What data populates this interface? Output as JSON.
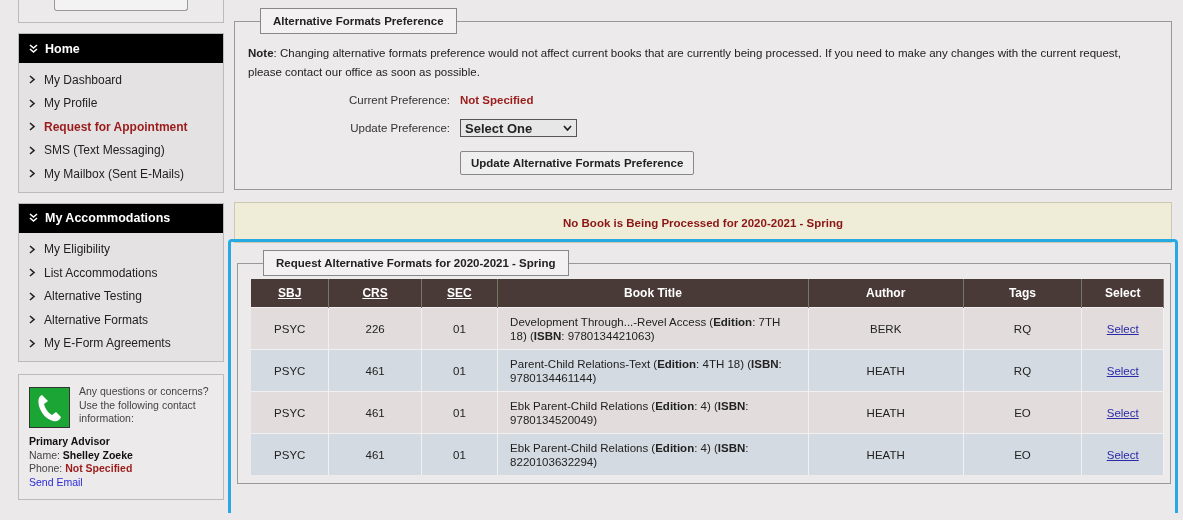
{
  "sidebar": {
    "panels": [
      {
        "title": "Home",
        "items": [
          {
            "label": "My Dashboard",
            "selected": false
          },
          {
            "label": "My Profile",
            "selected": false
          },
          {
            "label": "Request for Appointment",
            "selected": true
          },
          {
            "label": "SMS (Text Messaging)",
            "selected": false
          },
          {
            "label": "My Mailbox (Sent E-Mails)",
            "selected": false
          }
        ]
      },
      {
        "title": "My Accommodations",
        "items": [
          {
            "label": "My Eligibility",
            "selected": false
          },
          {
            "label": "List Accommodations",
            "selected": false
          },
          {
            "label": "Alternative Testing",
            "selected": false
          },
          {
            "label": "Alternative Formats",
            "selected": false
          },
          {
            "label": "My E-Form Agreements",
            "selected": false
          }
        ]
      }
    ],
    "contact": {
      "message": "Any questions or concerns? Use the following contact information:",
      "role": "Primary Advisor",
      "name_label": "Name:",
      "name": "Shelley Zoeke",
      "phone_label": "Phone:",
      "phone": "Not Specified",
      "email_link": "Send Email"
    }
  },
  "preference": {
    "legend": "Alternative Formats Preference",
    "note": "**Note**: Changing alternative formats preference would not affect current books that are currently being processed. If you need to make any changes with the current request, please contact our office as soon as possible.",
    "current_label": "Current Preference:",
    "current_value": "Not Specified",
    "update_label": "Update Preference:",
    "select_value": "Select One",
    "button": "Update Alternative Formats Preference"
  },
  "banner": "No Book is Being Processed for 2020-2021 - Spring",
  "request": {
    "highlighted": true,
    "legend": "Request Alternative Formats for 2020-2021 - Spring",
    "table": {
      "columns": [
        {
          "label": "SBJ",
          "sortable": true
        },
        {
          "label": "CRS",
          "sortable": true
        },
        {
          "label": "SEC",
          "sortable": true
        },
        {
          "label": "Book Title",
          "sortable": false
        },
        {
          "label": "Author",
          "sortable": false
        },
        {
          "label": "Tags",
          "sortable": false
        },
        {
          "label": "Select",
          "sortable": false
        }
      ],
      "rows": [
        {
          "cells": [
            "PSYC",
            "226",
            "01",
            "Development Through...-Revel Access (**Edition**: 7TH 18) (**ISBN**: 9780134421063)",
            "BERK",
            "RQ"
          ],
          "action": "Select"
        },
        {
          "cells": [
            "PSYC",
            "461",
            "01",
            "Parent-Child Relations-Text (**Edition**: 4TH 18) (**ISBN**: 9780134461144)",
            "HEATH",
            "RQ"
          ],
          "action": "Select"
        },
        {
          "cells": [
            "PSYC",
            "461",
            "01",
            "Ebk Parent-Child Relations (**Edition**: 4) (**ISBN**: 9780134520049)",
            "HEATH",
            "EO"
          ],
          "action": "Select"
        },
        {
          "cells": [
            "PSYC",
            "461",
            "01",
            "Ebk Parent-Child Relations (**Edition**: 4) (**ISBN**: 8220103632294)",
            "HEATH",
            "EO"
          ],
          "action": "Select"
        }
      ]
    }
  }
}
